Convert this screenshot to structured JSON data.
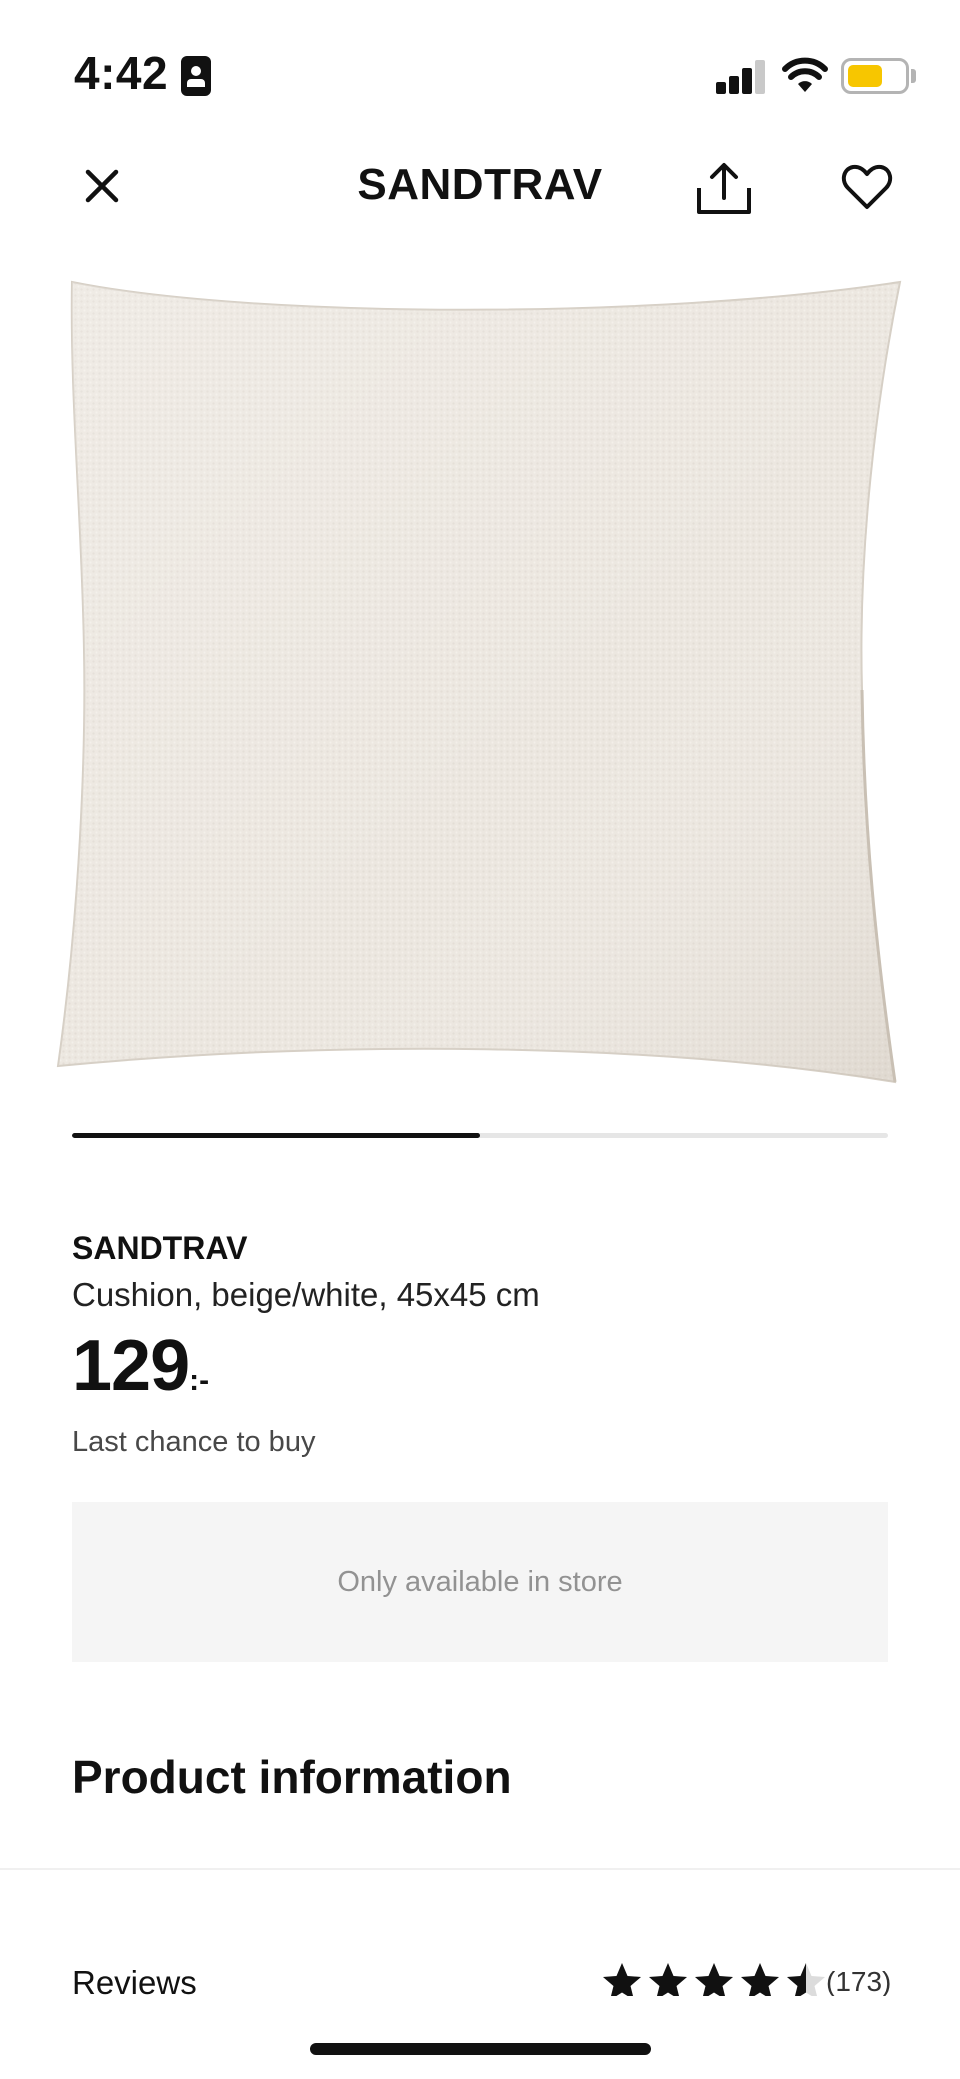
{
  "status_bar": {
    "time": "4:42",
    "battery_level": 0.6,
    "battery_color": "#f7c600"
  },
  "nav": {
    "title": "SANDTRAV",
    "icons": [
      "close-icon",
      "share-icon",
      "heart-icon"
    ]
  },
  "gallery": {
    "image_count": 2,
    "current_image": 1,
    "progress": 0.5
  },
  "product": {
    "name": "SANDTRAV",
    "description": "Cushion, beige/white, 45x45 cm",
    "price": "129",
    "price_suffix": ":-",
    "last_chance": "Last chance to buy",
    "availability": "Only available in store"
  },
  "section": {
    "product_information": "Product information"
  },
  "reviews": {
    "label": "Reviews",
    "rating": 4.5,
    "count": "(173)"
  },
  "colors": {
    "text": "#111111",
    "muted": "#929292",
    "panel": "#f5f5f5",
    "accent_battery": "#f7c600"
  }
}
